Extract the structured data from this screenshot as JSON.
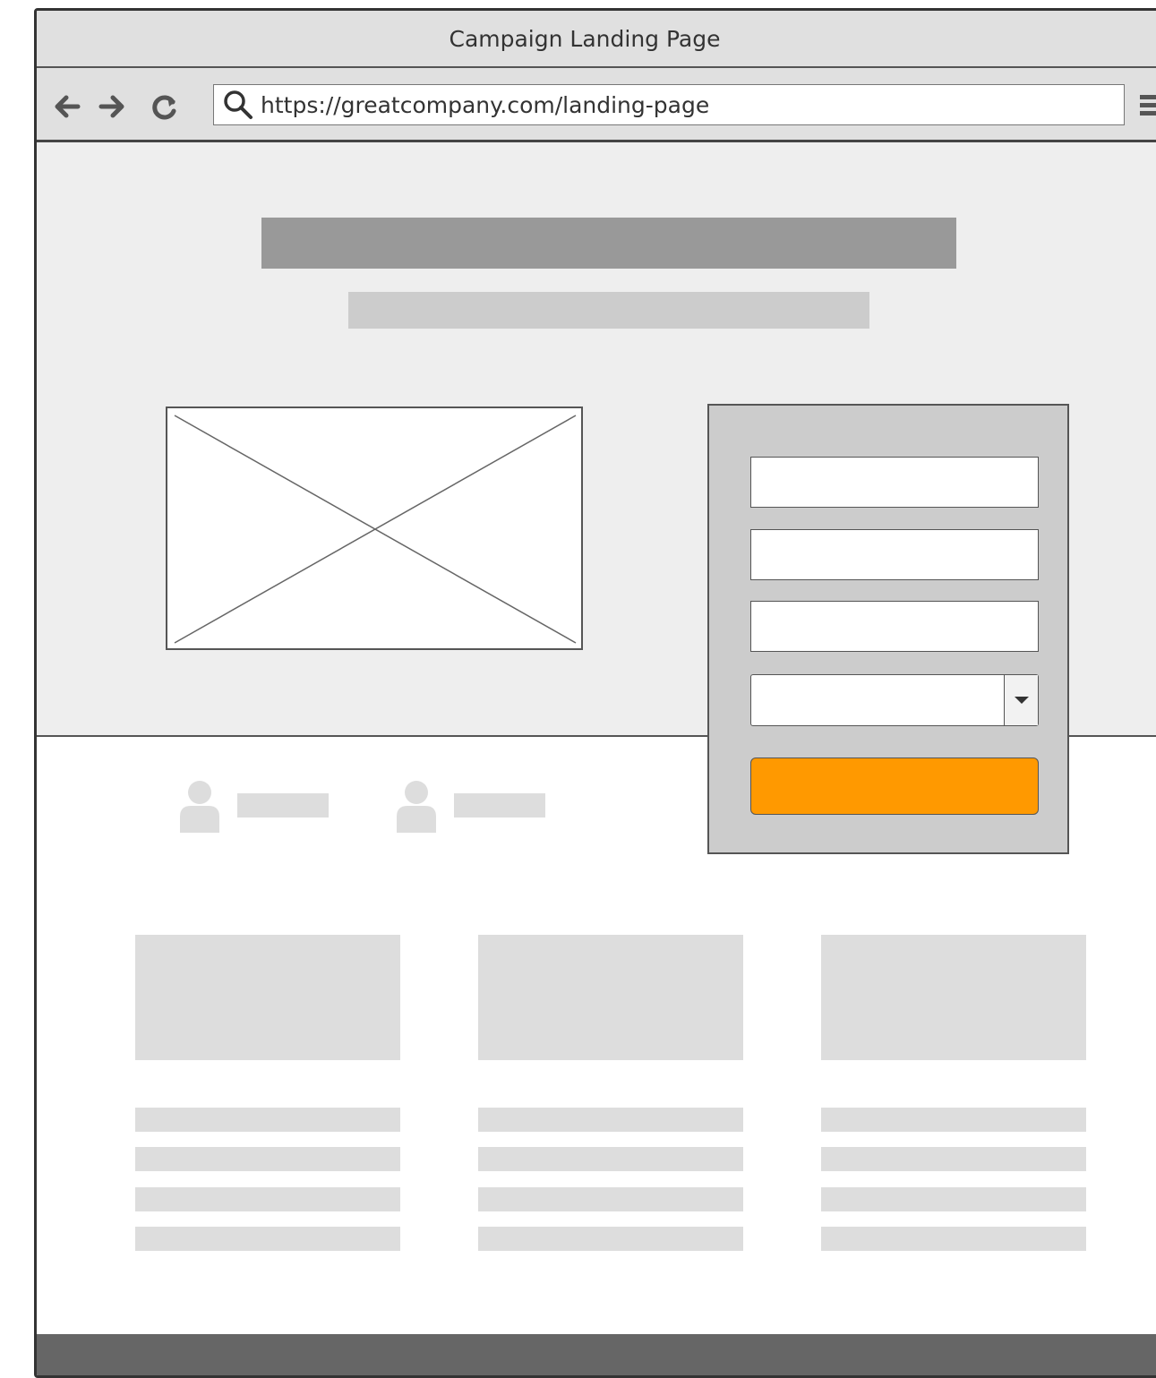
{
  "window": {
    "title": "Campaign Landing Page"
  },
  "toolbar": {
    "back_icon": "arrow-left-icon",
    "forward_icon": "arrow-right-icon",
    "reload_icon": "reload-icon",
    "address": {
      "icon": "search-icon",
      "url": "https://greatcompany.com/landing-page"
    },
    "menu_icon": "hamburger-menu-icon"
  },
  "hero": {
    "image_placeholder": "image-placeholder"
  },
  "form": {
    "inputs": [
      "",
      "",
      ""
    ],
    "select": {
      "value": "",
      "icon": "caret-down-icon"
    },
    "submit": {
      "label": "",
      "color": "#ff9900"
    }
  },
  "testimonials": [
    {
      "icon": "user-icon"
    },
    {
      "icon": "user-icon"
    }
  ],
  "features": [
    {
      "image": "placeholder",
      "lines": 4
    },
    {
      "image": "placeholder",
      "lines": 4
    },
    {
      "image": "placeholder",
      "lines": 4
    }
  ],
  "colors": {
    "chrome": "#e0e0e0",
    "hero_bg": "#eeeeee",
    "accent": "#ff9900",
    "footer": "#666666"
  }
}
